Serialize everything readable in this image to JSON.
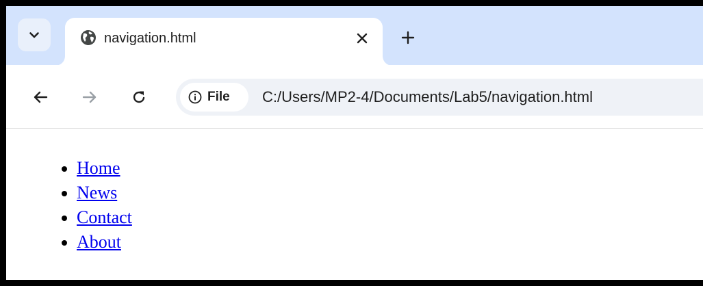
{
  "tab": {
    "title": "navigation.html"
  },
  "toolbar": {
    "site_info_label": "File",
    "url": "C:/Users/MP2-4/Documents/Lab5/navigation.html"
  },
  "icons": {
    "tab_search": "chevron-down-icon",
    "favicon": "globe-icon",
    "close": "close-icon",
    "new_tab": "plus-icon",
    "back": "arrow-left-icon",
    "forward": "arrow-right-icon",
    "reload": "reload-icon",
    "site_info": "info-icon"
  },
  "colors": {
    "tabstrip": "#d3e3fd",
    "omnibox": "#eff2f7",
    "link": "#0000ee",
    "forward_disabled": "#9aa0a6"
  },
  "nav": {
    "items": [
      {
        "label": "Home"
      },
      {
        "label": "News"
      },
      {
        "label": "Contact"
      },
      {
        "label": "About"
      }
    ]
  }
}
